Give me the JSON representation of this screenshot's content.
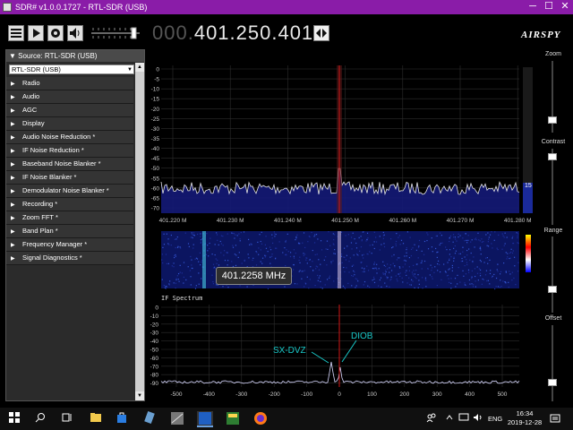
{
  "window": {
    "title": "SDR# v1.0.0.1727 - RTL-SDR (USB)",
    "minimize": "─",
    "maximize": "☐",
    "close": "✕"
  },
  "toolbar": {
    "freq_dim": "000.",
    "freq_main": "401.250.401",
    "brand": "AIRSPY"
  },
  "panel": {
    "source_header": "Source: RTL-SDR (USB)",
    "source_select": "RTL-SDR (USB)",
    "items": [
      "Radio",
      "Audio",
      "AGC",
      "Display",
      "Audio Noise Reduction *",
      "IF Noise Reduction *",
      "Baseband Noise Blanker *",
      "IF Noise Blanker *",
      "Demodulator Noise Blanker *",
      "Recording *",
      "Zoom FFT *",
      "Band Plan *",
      "Frequency Manager *",
      "Signal Diagnostics *"
    ]
  },
  "spectrum": {
    "y_ticks": [
      "0",
      "-5",
      "-10",
      "-15",
      "-20",
      "-25",
      "-30",
      "-35",
      "-40",
      "-45",
      "-50",
      "-55",
      "-60",
      "-65",
      "-70"
    ],
    "x_ticks": [
      "401.220 M",
      "401.230 M",
      "401.240 M",
      "401.250 M",
      "401.260 M",
      "401.270 M",
      "401.280 M"
    ],
    "level": "15"
  },
  "waterfall": {
    "tooltip": "401.2258 MHz"
  },
  "if_spectrum": {
    "title": "IF Spectrum",
    "y_ticks": [
      "0",
      "-10",
      "-20",
      "-30",
      "-40",
      "-50",
      "-60",
      "-70",
      "-80",
      "-90"
    ],
    "x_ticks": [
      "-500",
      "-400",
      "-300",
      "-200",
      "-100",
      "0",
      "100",
      "200",
      "300",
      "400",
      "500"
    ],
    "annotations": [
      "SX-DVZ",
      "DIOB"
    ]
  },
  "right": {
    "zoom": "Zoom",
    "contrast": "Contrast",
    "range": "Range",
    "offset": "Offset"
  },
  "taskbar": {
    "lang": "ENG",
    "time": "16:34",
    "date": "2019-12-28"
  },
  "colors": {
    "titlebar": "#8a1ca8",
    "plot_bg": "#0a0a46",
    "trace": "#e6e6e6",
    "center_line": "#d01616",
    "annotation": "#19c8c8"
  }
}
